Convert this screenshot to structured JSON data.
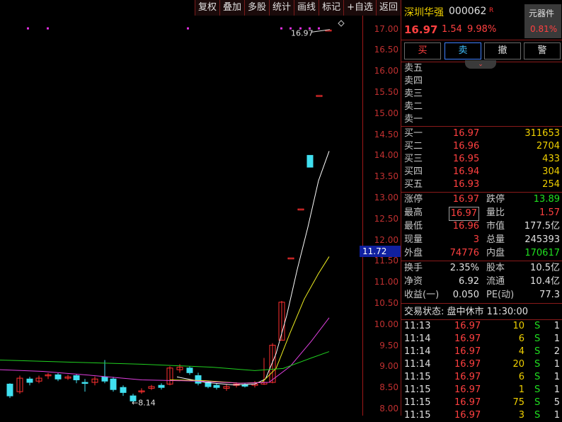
{
  "toolbar": [
    "复权",
    "叠加",
    "多股",
    "统计",
    "画线",
    "标记",
    "+自选",
    "返回"
  ],
  "chart": {
    "price_ticks": [
      "17.00",
      "16.50",
      "16.00",
      "15.50",
      "15.00",
      "14.50",
      "14.00",
      "13.50",
      "13.00",
      "12.50",
      "12.00",
      "11.50",
      "11.00",
      "10.50",
      "10.00",
      "9.50",
      "9.00",
      "8.50",
      "8.00"
    ],
    "current_price_label": "11.72",
    "high_label": "16.97",
    "low_label": "8.14",
    "colors": {
      "up": "#ff3030",
      "down": "#40e0f0",
      "ma1": "#ffffff",
      "ma2": "#f0f020",
      "ma3": "#e040e0",
      "ma4": "#20d020"
    }
  },
  "quote": {
    "name": "深圳华强",
    "code": "000062",
    "tag": "R",
    "price": "16.97",
    "change": "1.54",
    "change_pct": "9.98%",
    "sector": "元器件",
    "sector_pct": "0.81%",
    "buttons": [
      "买",
      "卖",
      "撤",
      "警"
    ],
    "asks": [
      "卖五",
      "卖四",
      "卖三",
      "卖二",
      "卖一"
    ],
    "bids": [
      {
        "label": "买一",
        "price": "16.97",
        "vol": "311653"
      },
      {
        "label": "买二",
        "price": "16.96",
        "vol": "2704"
      },
      {
        "label": "买三",
        "price": "16.95",
        "vol": "433"
      },
      {
        "label": "买四",
        "price": "16.94",
        "vol": "304"
      },
      {
        "label": "买五",
        "price": "16.93",
        "vol": "254"
      }
    ],
    "stats1": [
      {
        "l1": "涨停",
        "v1": "16.97",
        "c1": "red",
        "l2": "跌停",
        "v2": "13.89",
        "c2": "green"
      },
      {
        "l1": "最高",
        "v1": "16.97",
        "c1": "red",
        "l2": "量比",
        "v2": "1.57",
        "c2": "red"
      },
      {
        "l1": "最低",
        "v1": "16.96",
        "c1": "red",
        "l2": "市值",
        "v2": "177.5亿",
        "c2": "white"
      },
      {
        "l1": "现量",
        "v1": "3",
        "c1": "red",
        "l2": "总量",
        "v2": "245393",
        "c2": "white"
      },
      {
        "l1": "外盘",
        "v1": "74776",
        "c1": "red",
        "l2": "内盘",
        "v2": "170617",
        "c2": "green"
      }
    ],
    "stats2": [
      {
        "l1": "换手",
        "v1": "2.35%",
        "l2": "股本",
        "v2": "10.5亿"
      },
      {
        "l1": "净资",
        "v1": "6.92",
        "l2": "流通",
        "v2": "10.4亿"
      },
      {
        "l1": "收益(一)",
        "v1": "0.050",
        "l2": "PE(动)",
        "v2": "77.3"
      }
    ],
    "trade_status": "交易状态: 盘中休市 11:30:00",
    "ticks": [
      {
        "t": "11:13",
        "p": "16.97",
        "v": "10",
        "s": "S",
        "n": "1"
      },
      {
        "t": "11:14",
        "p": "16.97",
        "v": "6",
        "s": "S",
        "n": "1"
      },
      {
        "t": "11:14",
        "p": "16.97",
        "v": "4",
        "s": "S",
        "n": "2"
      },
      {
        "t": "11:14",
        "p": "16.97",
        "v": "20",
        "s": "S",
        "n": "1"
      },
      {
        "t": "11:15",
        "p": "16.97",
        "v": "6",
        "s": "S",
        "n": "1"
      },
      {
        "t": "11:15",
        "p": "16.97",
        "v": "1",
        "s": "S",
        "n": "1"
      },
      {
        "t": "11:15",
        "p": "16.97",
        "v": "75",
        "s": "S",
        "n": "5"
      },
      {
        "t": "11:15",
        "p": "16.97",
        "v": "3",
        "s": "S",
        "n": "1"
      }
    ]
  }
}
